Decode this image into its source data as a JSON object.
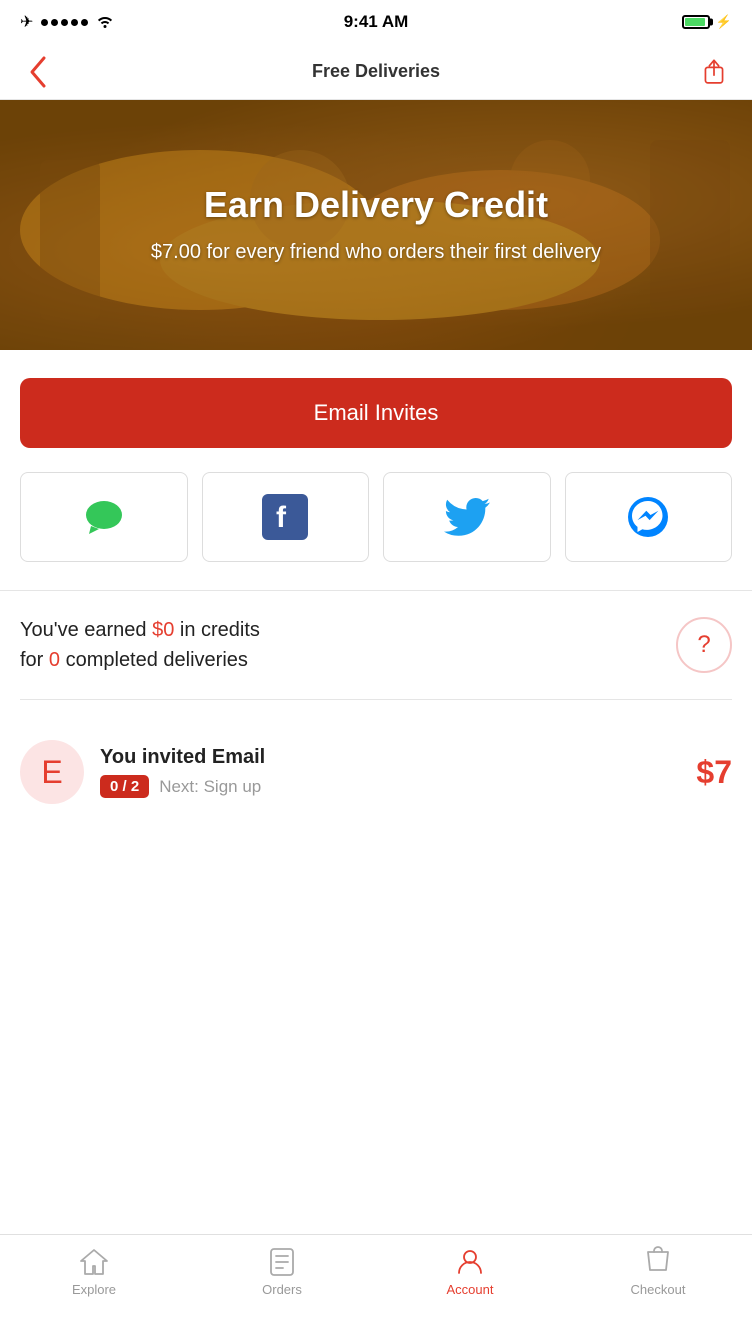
{
  "statusBar": {
    "time": "9:41 AM",
    "airplane": "✈",
    "dots": [
      "•",
      "•",
      "•",
      "•",
      "•"
    ]
  },
  "header": {
    "title": "Free Deliveries",
    "backLabel": "<",
    "shareLabel": "share"
  },
  "hero": {
    "title": "Earn Delivery Credit",
    "subtitle": "$7.00 for every friend who orders their first delivery"
  },
  "emailButton": {
    "label": "Email Invites"
  },
  "socialButtons": [
    {
      "id": "messages",
      "label": "Messages"
    },
    {
      "id": "facebook",
      "label": "Facebook"
    },
    {
      "id": "twitter",
      "label": "Twitter"
    },
    {
      "id": "messenger",
      "label": "Messenger"
    }
  ],
  "credits": {
    "prefix": "You've earned ",
    "amount": "$0",
    "middle": " in credits",
    "forText": "for ",
    "count": "0",
    "suffix": " completed deliveries"
  },
  "invited": {
    "avatarLetter": "E",
    "title": "You invited Email",
    "progress": "0 / 2",
    "nextStep": "Next: Sign up",
    "reward": "$7"
  },
  "tabBar": {
    "tabs": [
      {
        "id": "explore",
        "label": "Explore",
        "icon": "home"
      },
      {
        "id": "orders",
        "label": "Orders",
        "icon": "clipboard"
      },
      {
        "id": "account",
        "label": "Account",
        "icon": "person",
        "active": true
      },
      {
        "id": "checkout",
        "label": "Checkout",
        "icon": "bag"
      }
    ]
  }
}
